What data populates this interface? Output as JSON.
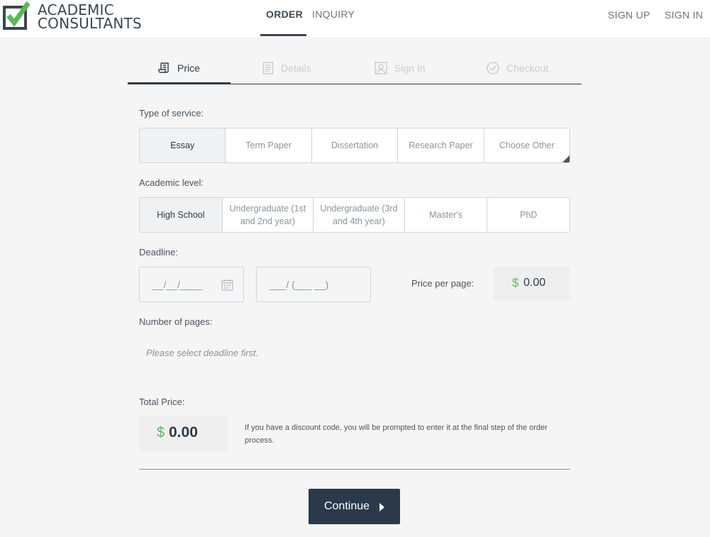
{
  "header": {
    "logo_line1": "ACADEMIC",
    "logo_line2": "CONSULTANTS",
    "nav": {
      "order": "ORDER",
      "inquiry": "INQUIRY",
      "sign_up": "SIGN UP",
      "sign_in": "SIGN IN"
    }
  },
  "steps": [
    {
      "label": "Price",
      "icon": "price-scroll-icon",
      "active": true
    },
    {
      "label": "Details",
      "icon": "document-icon",
      "active": false
    },
    {
      "label": "Sign In",
      "icon": "user-icon",
      "active": false
    },
    {
      "label": "Checkout",
      "icon": "check-circle-icon",
      "active": false
    }
  ],
  "form": {
    "service_label": "Type of service:",
    "services": [
      "Essay",
      "Term Paper",
      "Dissertation",
      "Research Paper",
      "Choose Other"
    ],
    "level_label": "Academic level:",
    "levels": [
      "High School",
      "Undergraduate (1st and 2nd year)",
      "Undergraduate (3rd and 4th year)",
      "Master's",
      "PhD"
    ],
    "deadline_label": "Deadline:",
    "date_placeholder": "__/__/____",
    "time_placeholder": "___/ (___ __)",
    "price_per_page_label": "Price per page:",
    "currency": "$",
    "price_per_page": "0.00",
    "pages_label": "Number of pages:",
    "pages_hint": "Please select deadline first.",
    "total_label": "Total Price:",
    "total_price": "0.00",
    "discount_note": "If you have a discount code, you will be prompted to enter it at the final step of the order process.",
    "continue_label": "Continue"
  },
  "colors": {
    "accent": "#2b3a4a",
    "currency": "#5cb85c",
    "logo_green": "#5cb85c"
  }
}
